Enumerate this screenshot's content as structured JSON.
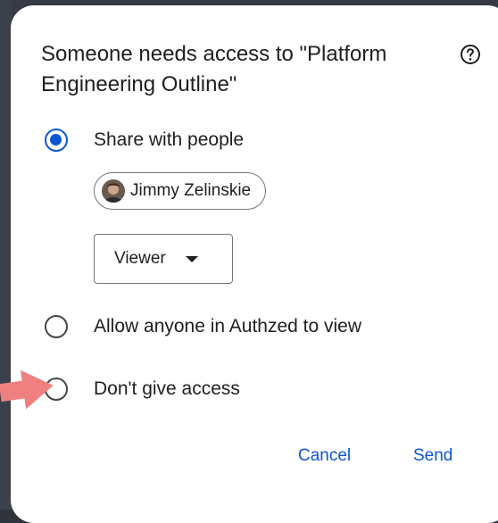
{
  "dialog": {
    "title": "Someone needs access to \"Platform Engineering Outline\"",
    "help_icon": "help-circle-icon"
  },
  "options": {
    "share_with_people": {
      "label": "Share with people",
      "selected": true
    },
    "allow_domain": {
      "label": "Allow anyone in Authzed to view",
      "selected": false
    },
    "no_access": {
      "label": "Don't give access",
      "selected": false
    }
  },
  "recipient": {
    "name": "Jimmy Zelinskie",
    "avatar": "user-avatar"
  },
  "role": {
    "selected": "Viewer",
    "icon": "dropdown-caret-icon"
  },
  "actions": {
    "cancel_label": "Cancel",
    "send_label": "Send"
  },
  "colors": {
    "accent": "#0b57d0",
    "annotation_arrow": "#f08080"
  }
}
